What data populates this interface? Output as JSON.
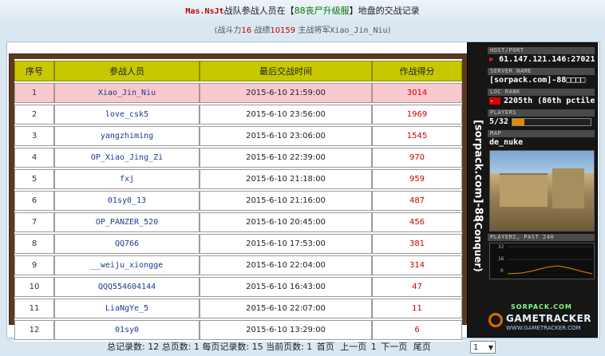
{
  "header": {
    "team_name": "Mas.NsJt",
    "title_pre": "战队参战人员在【",
    "server_name": "88丧尸升级服",
    "title_post": "】地盘的交战记录"
  },
  "summary": {
    "open": "(战斗力",
    "power": "16",
    "wins_label": " 战绩",
    "wins": "10159",
    "general_label": " 主战将军",
    "general": "Xiao_Jin_Niu",
    "close": ")"
  },
  "table": {
    "headers": [
      "序号",
      "参战人员",
      "最后交战时间",
      "作战得分"
    ],
    "rows": [
      {
        "no": "1",
        "name": "Xiao_Jin_Niu",
        "time": "2015-6-10 21:59:00",
        "score": "3014"
      },
      {
        "no": "2",
        "name": "love_csk5",
        "time": "2015-6-10 23:56:00",
        "score": "1969"
      },
      {
        "no": "3",
        "name": "yangzhiming",
        "time": "2015-6-10 23:06:00",
        "score": "1545"
      },
      {
        "no": "4",
        "name": "OP_Xiao_Jing_Zi",
        "time": "2015-6-10 22:39:00",
        "score": "970"
      },
      {
        "no": "5",
        "name": "fxj",
        "time": "2015-6-10 21:18:00",
        "score": "959"
      },
      {
        "no": "6",
        "name": "01sy0_13",
        "time": "2015-6-10 21:16:00",
        "score": "487"
      },
      {
        "no": "7",
        "name": "OP_PANZER_520",
        "time": "2015-6-10 20:45:00",
        "score": "456"
      },
      {
        "no": "8",
        "name": "QQ766",
        "time": "2015-6-10 17:53:00",
        "score": "381"
      },
      {
        "no": "9",
        "name": "__weiju_xiongge",
        "time": "2015-6-10 22:04:00",
        "score": "314"
      },
      {
        "no": "10",
        "name": "QQQ554604144",
        "time": "2015-6-10 16:43:00",
        "score": "47"
      },
      {
        "no": "11",
        "name": "LiaNgYe_5",
        "time": "2015-6-10 22:07:00",
        "score": "11"
      },
      {
        "no": "12",
        "name": "01sy0",
        "time": "2015-6-10 13:29:00",
        "score": "6"
      }
    ]
  },
  "tracker": {
    "side_title": "[sorpack.com]-88",
    "side_sub": "(Conquer)",
    "host_label": "HOST/PORT",
    "host": "61.147.121.146:27021",
    "server_label": "SERVER NAME",
    "server": "[sorpack.com]-88□□□□",
    "rank_label": "LOC  RANK",
    "rank": "2205th (86th pctile)",
    "players_label": "PLAYERS",
    "players": "5/32",
    "players_fraction": 0.156,
    "map_label": "MAP",
    "map": "de_nuke",
    "chart_label": "PLAYERS, PAST 24H",
    "chart_ticks": [
      "32",
      "16",
      "0"
    ],
    "logo_top": "SORPACK.COM",
    "logo_brand": "GAMETRACKER",
    "logo_url": "WWW.GAMETRACKER.COM",
    "colors": {
      "flag": "#dd0000",
      "bar": "#e08a00"
    }
  },
  "pagination": {
    "text": "总记录数: 12 总页数: 1 每页记录数: 15 当前页数: 1",
    "first": "首页",
    "prev": "上一页",
    "page_num": "1",
    "next": "下一页",
    "last": "尾页",
    "selected": "1"
  }
}
